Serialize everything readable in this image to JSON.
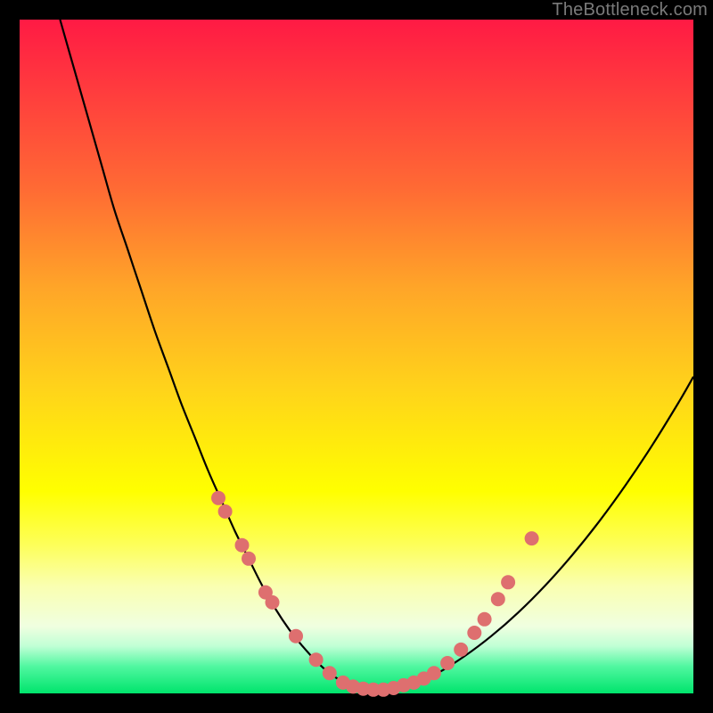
{
  "attribution": "TheBottleneck.com",
  "chart_data": {
    "type": "line",
    "title": "",
    "xlabel": "",
    "ylabel": "",
    "xlim": [
      0,
      100
    ],
    "ylim": [
      0,
      100
    ],
    "curve": {
      "x": [
        6,
        8,
        10,
        12,
        14,
        16,
        18,
        20,
        22,
        24,
        26,
        28,
        30,
        32,
        34,
        36,
        38,
        40,
        42,
        44,
        46,
        48,
        50,
        52,
        55,
        58,
        62,
        66,
        70,
        74,
        78,
        82,
        86,
        90,
        94,
        98,
        100
      ],
      "y": [
        100,
        93,
        86,
        79,
        72,
        66,
        60,
        54,
        48.5,
        43,
        38,
        33,
        28.5,
        24,
        20,
        16,
        12.5,
        9.5,
        7,
        4.8,
        3,
        1.7,
        0.9,
        0.5,
        0.6,
        1.3,
        3,
        5.5,
        8.5,
        12,
        16,
        20.5,
        25.5,
        31,
        37,
        43.5,
        47
      ]
    },
    "markers": [
      {
        "x": 29.5,
        "y": 29
      },
      {
        "x": 30.5,
        "y": 27
      },
      {
        "x": 33,
        "y": 22
      },
      {
        "x": 34,
        "y": 20
      },
      {
        "x": 36.5,
        "y": 15
      },
      {
        "x": 37.5,
        "y": 13.5
      },
      {
        "x": 41,
        "y": 8.5
      },
      {
        "x": 44,
        "y": 5
      },
      {
        "x": 46,
        "y": 3
      },
      {
        "x": 48,
        "y": 1.6
      },
      {
        "x": 49.5,
        "y": 1.0
      },
      {
        "x": 51,
        "y": 0.7
      },
      {
        "x": 52.5,
        "y": 0.55
      },
      {
        "x": 54,
        "y": 0.55
      },
      {
        "x": 55.5,
        "y": 0.8
      },
      {
        "x": 57,
        "y": 1.2
      },
      {
        "x": 58.5,
        "y": 1.6
      },
      {
        "x": 60,
        "y": 2.2
      },
      {
        "x": 61.5,
        "y": 3.0
      },
      {
        "x": 63.5,
        "y": 4.5
      },
      {
        "x": 65.5,
        "y": 6.5
      },
      {
        "x": 67.5,
        "y": 9.0
      },
      {
        "x": 69,
        "y": 11
      },
      {
        "x": 71,
        "y": 14
      },
      {
        "x": 72.5,
        "y": 16.5
      },
      {
        "x": 76,
        "y": 23
      }
    ],
    "marker_radius_px": 8
  }
}
